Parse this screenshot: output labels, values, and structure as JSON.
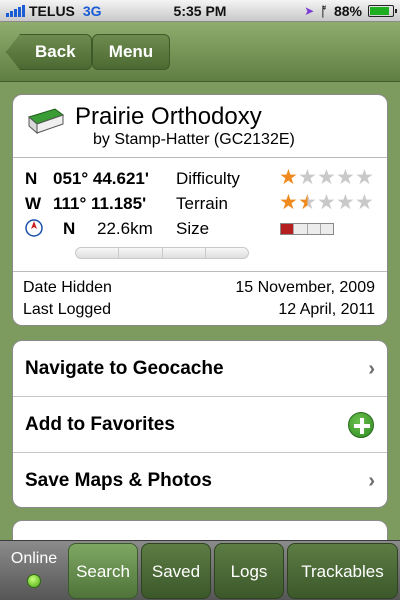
{
  "status_bar": {
    "carrier": "TELUS",
    "network": "3G",
    "time": "5:35 PM",
    "battery": "88%",
    "battery_level": 0.88,
    "icons": [
      "signal-icon",
      "location-arrow-icon",
      "bluetooth-icon",
      "battery-icon"
    ]
  },
  "nav": {
    "back_label": "Back",
    "menu_label": "Menu"
  },
  "cache": {
    "name": "Prairie Orthodoxy",
    "owner": "by Stamp-Hatter (GC2132E)",
    "lat_dir": "N",
    "lat": "051° 44.621'",
    "lon_dir": "W",
    "lon": "111° 11.185'",
    "bearing": "N",
    "distance": "22.6km",
    "difficulty_label": "Difficulty",
    "difficulty_rating": 1,
    "terrain_label": "Terrain",
    "terrain_rating": 1.5,
    "size_label": "Size",
    "size_level": 1,
    "size_scale": 4,
    "date_hidden_label": "Date Hidden",
    "date_hidden": "15 November, 2009",
    "last_logged_label": "Last Logged",
    "last_logged": "12 April, 2011"
  },
  "actions": [
    {
      "label": "Navigate to Geocache",
      "icon": "chevron-right-icon"
    },
    {
      "label": "Add to Favorites",
      "icon": "add-circle-icon"
    },
    {
      "label": "Save Maps & Photos",
      "icon": "chevron-right-icon"
    }
  ],
  "tab_bar": {
    "status_label": "Online",
    "status_color": "#49a814",
    "tabs": [
      {
        "label": "Search",
        "active": true
      },
      {
        "label": "Saved",
        "active": false
      },
      {
        "label": "Logs",
        "active": false
      },
      {
        "label": "Trackables",
        "active": false
      }
    ]
  },
  "colors": {
    "background": "#7d9b5e",
    "star": "#f08a1e",
    "size_fill": "#b61f1f"
  }
}
